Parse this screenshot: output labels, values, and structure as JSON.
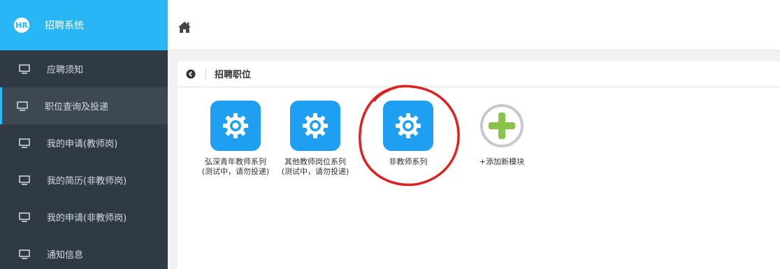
{
  "brand": {
    "logo": "HR",
    "title": "招聘系统"
  },
  "sidebar": {
    "items": [
      {
        "label": "应聘须知",
        "icon": "monitor-icon",
        "active": false
      },
      {
        "label": "职位查询及投递",
        "icon": "monitor-icon",
        "active": true
      },
      {
        "label": "我的申请(教师岗)",
        "icon": "monitor-icon",
        "active": false
      },
      {
        "label": "我的简历(非教师岗)",
        "icon": "monitor-icon",
        "active": false
      },
      {
        "label": "我的申请(非教师岗)",
        "icon": "monitor-icon",
        "active": false
      },
      {
        "label": "通知信息",
        "icon": "monitor-icon",
        "active": false
      }
    ]
  },
  "topbar": {
    "home_icon": "home-icon"
  },
  "breadcrumb": {
    "back_icon": "back-circle-icon",
    "title": "招聘职位"
  },
  "modules": [
    {
      "line1": "弘深青年教师系列",
      "line2": "(测试中，请勿投递)",
      "icon": "gear-icon"
    },
    {
      "line1": "其他教师岗位系列",
      "line2": "(测试中，请勿投递)",
      "icon": "gear-icon"
    },
    {
      "line1": "非教师系列",
      "line2": "",
      "icon": "gear-icon"
    }
  ],
  "add_module": {
    "label": "+添加新模块",
    "icon": "plus-circle-icon"
  },
  "colors": {
    "brand": "#29b6f6",
    "sidebar_bg": "#2f3a45",
    "module_icon": "#1e9ff2",
    "add_green": "#8bc34a",
    "annotation": "#e02020"
  }
}
